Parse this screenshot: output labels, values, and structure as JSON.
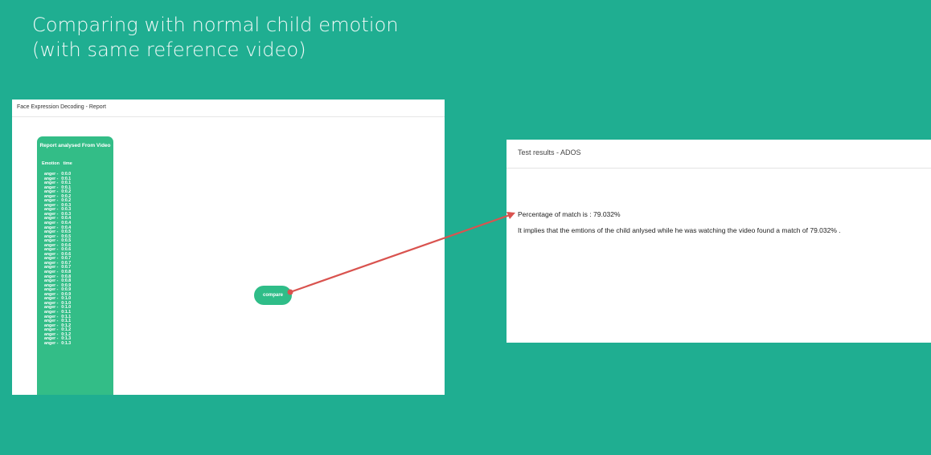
{
  "slide": {
    "title_line1": "Comparing with normal child emotion",
    "title_line2": "(with same reference video)"
  },
  "report": {
    "window_title": "Face Expression Decoding - Report",
    "panel_title": "Report analysed From Video",
    "columns": {
      "emotion": "Emotion",
      "time": "time"
    },
    "rows": [
      {
        "emotion": "anger -",
        "time": "0:0.0"
      },
      {
        "emotion": "anger -",
        "time": "0:0.1"
      },
      {
        "emotion": "anger -",
        "time": "0:0.1"
      },
      {
        "emotion": "anger -",
        "time": "0:0.1"
      },
      {
        "emotion": "anger -",
        "time": "0:0.2"
      },
      {
        "emotion": "anger -",
        "time": "0:0.2"
      },
      {
        "emotion": "anger -",
        "time": "0:0.2"
      },
      {
        "emotion": "anger -",
        "time": "0:0.3"
      },
      {
        "emotion": "anger -",
        "time": "0:0.3"
      },
      {
        "emotion": "anger -",
        "time": "0:0.3"
      },
      {
        "emotion": "anger -",
        "time": "0:0.4"
      },
      {
        "emotion": "anger -",
        "time": "0:0.4"
      },
      {
        "emotion": "anger -",
        "time": "0:0.4"
      },
      {
        "emotion": "anger -",
        "time": "0:0.5"
      },
      {
        "emotion": "anger -",
        "time": "0:0.5"
      },
      {
        "emotion": "anger -",
        "time": "0:0.5"
      },
      {
        "emotion": "anger -",
        "time": "0:0.6"
      },
      {
        "emotion": "anger -",
        "time": "0:0.6"
      },
      {
        "emotion": "anger -",
        "time": "0:0.6"
      },
      {
        "emotion": "anger -",
        "time": "0:0.7"
      },
      {
        "emotion": "anger -",
        "time": "0:0.7"
      },
      {
        "emotion": "anger -",
        "time": "0:0.7"
      },
      {
        "emotion": "anger -",
        "time": "0:0.8"
      },
      {
        "emotion": "anger -",
        "time": "0:0.8"
      },
      {
        "emotion": "anger -",
        "time": "0:0.8"
      },
      {
        "emotion": "anger -",
        "time": "0:0.9"
      },
      {
        "emotion": "anger -",
        "time": "0:0.9"
      },
      {
        "emotion": "anger -",
        "time": "0:0.9"
      },
      {
        "emotion": "anger -",
        "time": "0:1.0"
      },
      {
        "emotion": "anger -",
        "time": "0:1.0"
      },
      {
        "emotion": "anger -",
        "time": "0:1.0"
      },
      {
        "emotion": "anger -",
        "time": "0:1.1"
      },
      {
        "emotion": "anger -",
        "time": "0:1.1"
      },
      {
        "emotion": "anger -",
        "time": "0:1.1"
      },
      {
        "emotion": "anger -",
        "time": "0:1.2"
      },
      {
        "emotion": "anger -",
        "time": "0:1.2"
      },
      {
        "emotion": "anger -",
        "time": "0:1.2"
      },
      {
        "emotion": "anger -",
        "time": "0:1.3"
      },
      {
        "emotion": "anger -",
        "time": "0:1.3"
      }
    ],
    "compare_label": "compare"
  },
  "results": {
    "window_title": "Test results - ADOS",
    "match_text": "Percentage of match is : 79.032%",
    "implication_text": "It implies that the emtions of the child anlysed while he was watching the video found a match of  79.032% ."
  },
  "colors": {
    "slide_background": "#1fae91",
    "panel_green": "#33bd87",
    "arrow": "#d9534f"
  }
}
